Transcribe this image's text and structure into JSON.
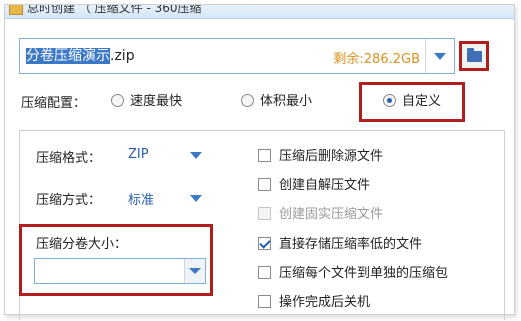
{
  "window": {
    "title": "总时创建  （ 压缩文件 - 360压缩"
  },
  "archive_name": {
    "selected": "分卷压缩演示",
    "extension": ".zip",
    "remaining": "剩余:286.2GB"
  },
  "config": {
    "label": "压缩配置：",
    "options": [
      {
        "label": "速度最快",
        "checked": false
      },
      {
        "label": "体积最小",
        "checked": false
      },
      {
        "label": "自定义",
        "checked": true
      }
    ]
  },
  "settings": {
    "format": {
      "label": "压缩格式：",
      "value": "ZIP"
    },
    "method": {
      "label": "压缩方式：",
      "value": "标准"
    },
    "split": {
      "label": "压缩分卷大小：",
      "value": ""
    }
  },
  "checkboxes": [
    {
      "label": "压缩后删除源文件",
      "checked": false,
      "disabled": false
    },
    {
      "label": "创建自解压文件",
      "checked": false,
      "disabled": false
    },
    {
      "label": "创建固实压缩文件",
      "checked": false,
      "disabled": true
    },
    {
      "label": "直接存储压缩率低的文件",
      "checked": true,
      "disabled": false
    },
    {
      "label": "压缩每个文件到单独的压缩包",
      "checked": false,
      "disabled": false
    },
    {
      "label": "操作完成后关机",
      "checked": false,
      "disabled": false
    }
  ],
  "colors": {
    "highlight": "#b01e1e",
    "accent": "#3d78c2",
    "remaining": "#d9921f"
  }
}
